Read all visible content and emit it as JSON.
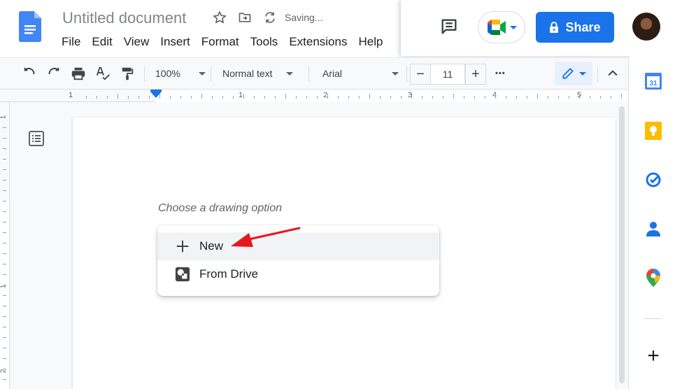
{
  "document": {
    "title": "Untitled document",
    "status": "Saving...",
    "menu": [
      "File",
      "Edit",
      "View",
      "Insert",
      "Format",
      "Tools",
      "Extensions",
      "Help"
    ]
  },
  "header": {
    "share_label": "Share"
  },
  "toolbar": {
    "zoom": "100%",
    "style": "Normal text",
    "font": "Arial",
    "font_size": "11",
    "decrease_label": "−",
    "increase_label": "+",
    "more_label": "•••"
  },
  "ruler": {
    "horizontal_labels": [
      "1",
      "1",
      "2",
      "3",
      "4",
      "5"
    ],
    "vertical_labels": [
      "1",
      "1",
      "2"
    ]
  },
  "drawing_dialog": {
    "prompt": "Choose a drawing option",
    "options": [
      {
        "label": "New",
        "icon": "plus-icon"
      },
      {
        "label": "From Drive",
        "icon": "drive-drawing-icon"
      }
    ]
  },
  "side_panel": {
    "apps": [
      "calendar-icon",
      "keep-icon",
      "tasks-icon",
      "contacts-icon",
      "maps-icon"
    ],
    "add_label": "+"
  },
  "colors": {
    "accent": "#1a73e8",
    "arrow": "#e8161e"
  }
}
